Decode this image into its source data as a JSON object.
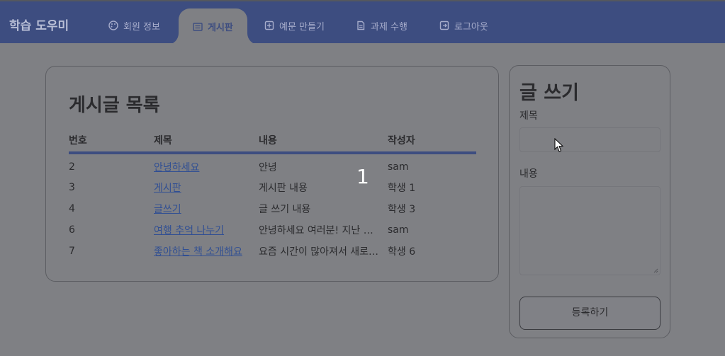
{
  "app": {
    "brand": "학습 도우미"
  },
  "nav": {
    "items": [
      {
        "label": "회원 정보",
        "icon": "palette-icon"
      },
      {
        "label": "게시판",
        "icon": "board-icon"
      },
      {
        "label": "예문 만들기",
        "icon": "plus-square-icon"
      },
      {
        "label": "과제 수행",
        "icon": "document-icon"
      },
      {
        "label": "로그아웃",
        "icon": "logout-icon"
      }
    ],
    "active": "게시판"
  },
  "post_list": {
    "title": "게시글 목록",
    "columns": [
      "번호",
      "제목",
      "내용",
      "작성자"
    ],
    "rows": [
      {
        "id": "2",
        "title": "안녕하세요",
        "content": "안녕",
        "author": "sam"
      },
      {
        "id": "3",
        "title": "게시판",
        "content": "게시판 내용",
        "author": "학생 1"
      },
      {
        "id": "4",
        "title": "글쓰기",
        "content": "글 쓰기 내용",
        "author": "학생 3"
      },
      {
        "id": "6",
        "title": "여행 추억 나누기",
        "content": "안녕하세요 여러분! 지난 …",
        "author": "sam"
      },
      {
        "id": "7",
        "title": "좋아하는 책 소개해요",
        "content": "요즘 시간이 많아져서 새로…",
        "author": "학생 6"
      }
    ]
  },
  "write": {
    "title": "글 쓰기",
    "title_label": "제목",
    "title_value": "",
    "content_label": "내용",
    "content_value": "",
    "submit_label": "등록하기"
  },
  "overlay": {
    "page_indicator": "1"
  },
  "colors": {
    "nav_bg": "#3d4d80",
    "page_bg": "#7f8084",
    "link": "#314f93"
  }
}
